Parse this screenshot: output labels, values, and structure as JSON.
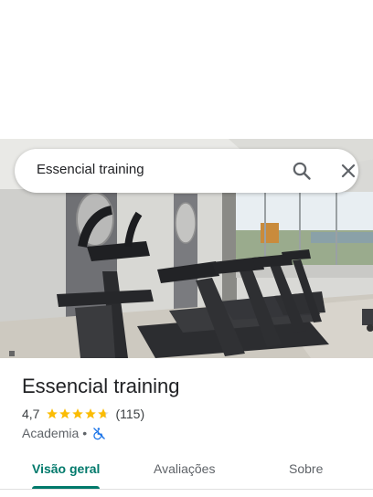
{
  "search": {
    "query": "Essencial training"
  },
  "place": {
    "title": "Essencial training",
    "rating": "4,7",
    "review_count": "(115)",
    "stars_filled": 4.7,
    "category": "Academia",
    "separator": "•",
    "accessibility_icon": "no-wheelchair-icon"
  },
  "tabs": [
    {
      "label": "Visão geral",
      "selected": true
    },
    {
      "label": "Avaliações",
      "selected": false
    },
    {
      "label": "Sobre",
      "selected": false
    }
  ],
  "colors": {
    "accent": "#00796b",
    "star": "#fbbc04",
    "access": "#1a73e8"
  },
  "photo": {
    "subject": "gym-treadmills"
  }
}
